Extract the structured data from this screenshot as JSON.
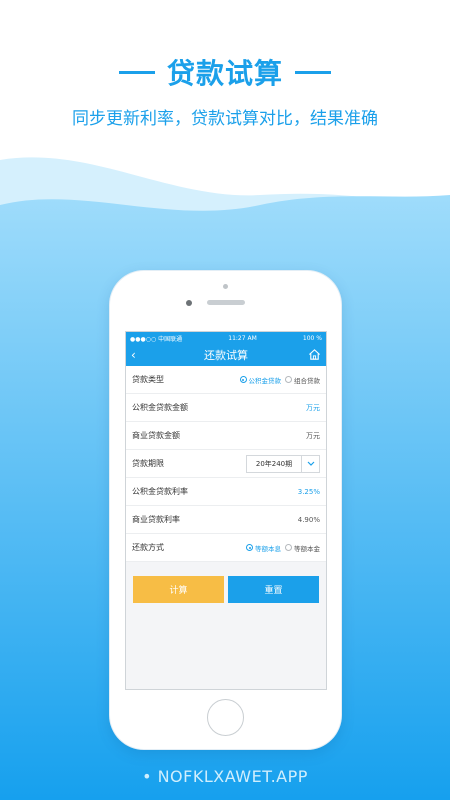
{
  "promo": {
    "title": "贷款试算",
    "subtitle": "同步更新利率，贷款试算对比，结果准确"
  },
  "status_bar": {
    "carrier": "●●●○○ 中国联通",
    "time": "11:27 AM",
    "battery": "100 %"
  },
  "nav": {
    "back_icon": "chevron-left-icon",
    "title": "还款试算",
    "home_icon": "home-icon"
  },
  "form": {
    "loan_type": {
      "label": "贷款类型",
      "options": [
        "公积金贷款",
        "组合贷款"
      ],
      "selected": "公积金贷款"
    },
    "fund_amount": {
      "label": "公积金贷款金额",
      "unit": "万元"
    },
    "commercial_amount": {
      "label": "商业贷款金额",
      "unit": "万元"
    },
    "term": {
      "label": "贷款期限",
      "value": "20年240期"
    },
    "fund_rate": {
      "label": "公积金贷款利率",
      "value": "3.25%"
    },
    "commercial_rate": {
      "label": "商业贷款利率",
      "value": "4.90%"
    },
    "repay_method": {
      "label": "还款方式",
      "options": [
        "等额本息",
        "等额本金"
      ],
      "selected": "等额本息"
    }
  },
  "buttons": {
    "calculate": "计算",
    "reset": "重置"
  },
  "footer": {
    "watermark": "• NOFKLXAWET.APP"
  },
  "colors": {
    "accent": "#1ba0ea",
    "calculate_button": "#f7bd45"
  }
}
